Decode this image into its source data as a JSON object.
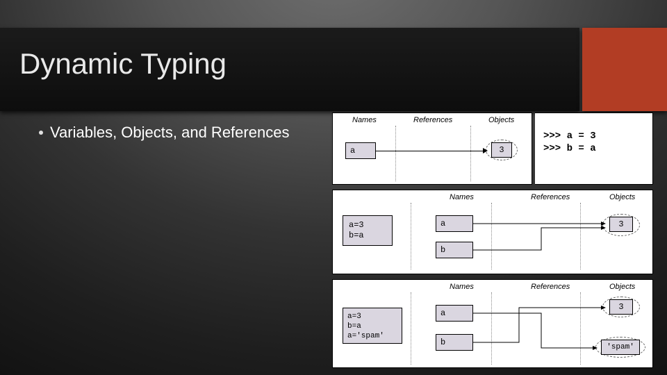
{
  "title": "Dynamic Typing",
  "bullet": "Variables, Objects, and References",
  "colors": {
    "accent": "#b23d24",
    "box_fill": "#dad6e0"
  },
  "columns": {
    "names": "Names",
    "references": "References",
    "objects": "Objects"
  },
  "code_side": {
    "line1": ">>> a = 3",
    "line2": ">>> b = a"
  },
  "diagram1": {
    "name": "a",
    "object": "3"
  },
  "diagram2": {
    "code": "a=3\nb=a",
    "name_a": "a",
    "name_b": "b",
    "object": "3"
  },
  "diagram3": {
    "code": "a=3\nb=a\na='spam'",
    "name_a": "a",
    "name_b": "b",
    "object_1": "3",
    "object_2": "'spam'"
  }
}
